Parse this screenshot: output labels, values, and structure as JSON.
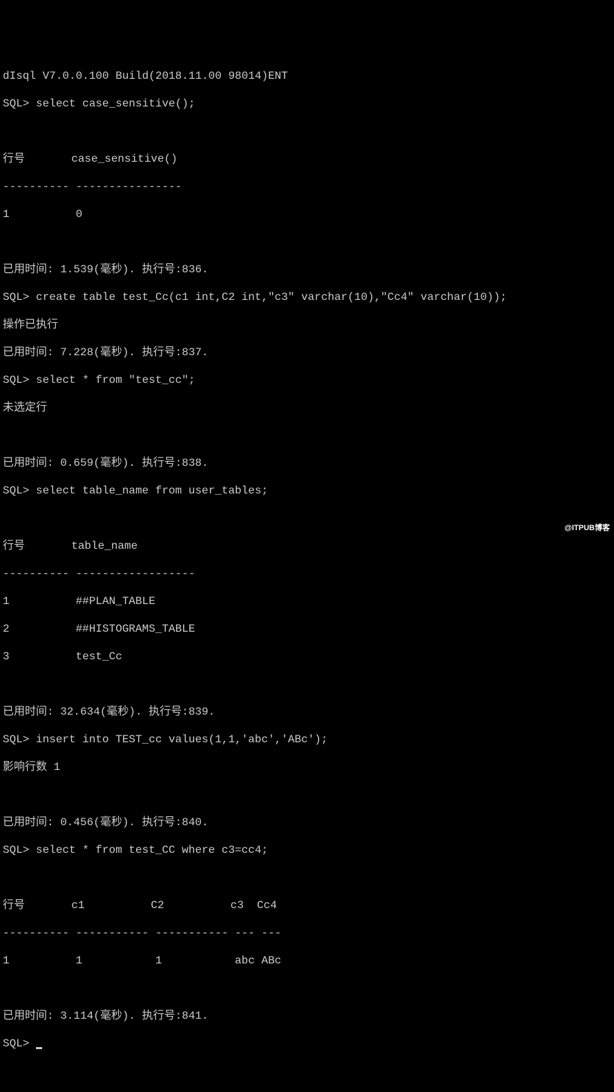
{
  "lines": {
    "l0": "dIsql V7.0.0.100 Build(2018.11.00 98014)ENT",
    "l1": "SQL> select case_sensitive();",
    "l2": "",
    "l3": "行号       case_sensitive()",
    "l4": "---------- ----------------",
    "l5": "1          0",
    "l6": "",
    "l7": "已用时间: 1.539(毫秒). 执行号:836.",
    "l8": "SQL> create table test_Cc(c1 int,C2 int,\"c3\" varchar(10),\"Cc4\" varchar(10));",
    "l9": "操作已执行",
    "l10": "已用时间: 7.228(毫秒). 执行号:837.",
    "l11": "SQL> select * from \"test_cc\";",
    "l12": "未选定行",
    "l13": "",
    "l14": "已用时间: 0.659(毫秒). 执行号:838.",
    "l15": "SQL> select table_name from user_tables;",
    "l16": "",
    "l17": "行号       table_name",
    "l18": "---------- ------------------",
    "l19": "1          ##PLAN_TABLE",
    "l20": "2          ##HISTOGRAMS_TABLE",
    "l21": "3          test_Cc",
    "l22": "",
    "l23": "已用时间: 32.634(毫秒). 执行号:839.",
    "l24": "SQL> insert into TEST_cc values(1,1,'abc','ABc');",
    "l25": "影响行数 1",
    "l26": "",
    "l27": "已用时间: 0.456(毫秒). 执行号:840.",
    "l28": "SQL> select * from test_CC where c3=cc4;",
    "l29": "",
    "l30": "行号       c1          C2          c3  Cc4",
    "l31": "---------- ----------- ----------- --- ---",
    "l32": "1          1           1           abc ABc",
    "l33": "",
    "l34": "已用时间: 3.114(毫秒). 执行号:841.",
    "l35": "SQL> "
  },
  "watermark": "@ITPUB博客"
}
